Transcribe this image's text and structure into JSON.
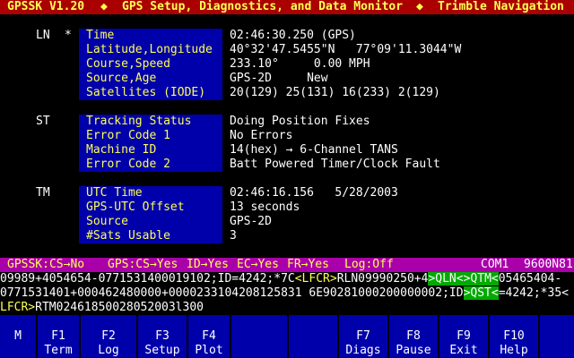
{
  "title": {
    "app": "GPSSK V1.20",
    "sep1": "◆",
    "heading": "GPS Setup, Diagnostics, and Data Monitor",
    "sep2": "◆",
    "vendor": "Trimble Navigation"
  },
  "ln": {
    "tag": "LN",
    "marker": "*",
    "rows": [
      {
        "label": "Time",
        "value": "02:46:30.250 (GPS)"
      },
      {
        "label": "Latitude,Longitude",
        "value": "40°32'47.5455\"N   77°09'11.3044\"W"
      },
      {
        "label": "Course,Speed",
        "value": "233.10°     0.00 MPH"
      },
      {
        "label": "Source,Age",
        "value": "GPS-2D     New"
      },
      {
        "label": "Satellites (IODE)",
        "value": "20(129) 25(131) 16(233) 2(129)"
      }
    ]
  },
  "st": {
    "tag": "ST",
    "rows": [
      {
        "label": "Tracking Status",
        "value": "Doing Position Fixes"
      },
      {
        "label": "Error Code 1",
        "value": "No Errors"
      },
      {
        "label": "Machine ID",
        "value": "14(hex) → 6-Channel TANS"
      },
      {
        "label": "Error Code 2",
        "value": "Batt Powered Timer/Clock Fault"
      }
    ]
  },
  "tm": {
    "tag": "TM",
    "rows": [
      {
        "label": "UTC Time",
        "value": "02:46:16.156   5/28/2003"
      },
      {
        "label": "GPS-UTC Offset",
        "value": "13 seconds"
      },
      {
        "label": "Source",
        "value": "GPS-2D"
      },
      {
        "label": "#Sats Usable",
        "value": "3"
      }
    ]
  },
  "status": {
    "gpssk": "GPSSK:CS→No",
    "gps": "GPS:CS→Yes",
    "id": "ID→Yes",
    "ec": "EC→Yes",
    "fr": "FR→Yes",
    "log": "Log:Off",
    "port": "COM1",
    "baud": "9600N81"
  },
  "stream": {
    "line1a": "09989+4054654-0771531400019102;ID=4242;*7C",
    "line1b": "<LFCR>",
    "line1c": "RLN09990250+4",
    "line1d": ">QLN<",
    "line1e": ">QTM<",
    "line1f": "05465404-",
    "line2a": "0771531401+000462480000+0000233104208125831 6E90281000200000002;ID",
    "line2b": ">QST<",
    "line2c": "=4242;*35<",
    "line3a": "LFCR>",
    "line3b": "RTM02461850028052003l300"
  },
  "fkeys": [
    {
      "key": "M",
      "action": ""
    },
    {
      "key": "F1",
      "action": "Term"
    },
    {
      "key": "F2",
      "action": "Log"
    },
    {
      "key": "F3",
      "action": "Setup"
    },
    {
      "key": "F4",
      "action": "Plot"
    },
    {
      "key": "",
      "action": ""
    },
    {
      "key": "",
      "action": ""
    },
    {
      "key": "F7",
      "action": "Diags"
    },
    {
      "key": "F8",
      "action": "Pause"
    },
    {
      "key": "F9",
      "action": "Exit"
    },
    {
      "key": "F10",
      "action": "Help"
    }
  ],
  "colors": {
    "title_bg": "#aa0000",
    "title_fg": "#ffff55",
    "label_bg": "#0000aa",
    "status_bg": "#aa00aa",
    "highlight_bg": "#00aa00"
  }
}
